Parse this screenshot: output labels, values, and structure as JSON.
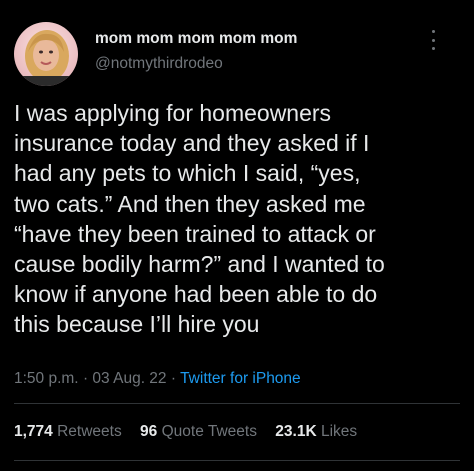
{
  "author": {
    "display_name": "mom mom mom mom mom",
    "handle": "@notmythirdrodeo",
    "avatar_icon": "user-avatar-photo"
  },
  "tweet": {
    "lines": [
      "I was applying for homeowners",
      "insurance today and they asked if I",
      "had any pets to which I said, “yes,",
      "two cats.”  And then they asked me",
      "“have they been trained to attack or",
      "cause bodily harm?” and I wanted to",
      "know if anyone had been able to do",
      "this because I’ll hire you"
    ]
  },
  "meta": {
    "time": "1:50 p.m.",
    "separator": "·",
    "date": "03 Aug. 22",
    "source": "Twitter for iPhone"
  },
  "stats": {
    "retweets_count": "1,774",
    "retweets_label": "Retweets",
    "quotes_count": "96",
    "quotes_label": "Quote Tweets",
    "likes_count": "23.1K",
    "likes_label": "Likes"
  },
  "colors": {
    "background": "#000000",
    "text": "#e7e9ea",
    "secondary": "#71767b",
    "link": "#1d9bf0",
    "avatar_ring": "#f3c9c9"
  }
}
